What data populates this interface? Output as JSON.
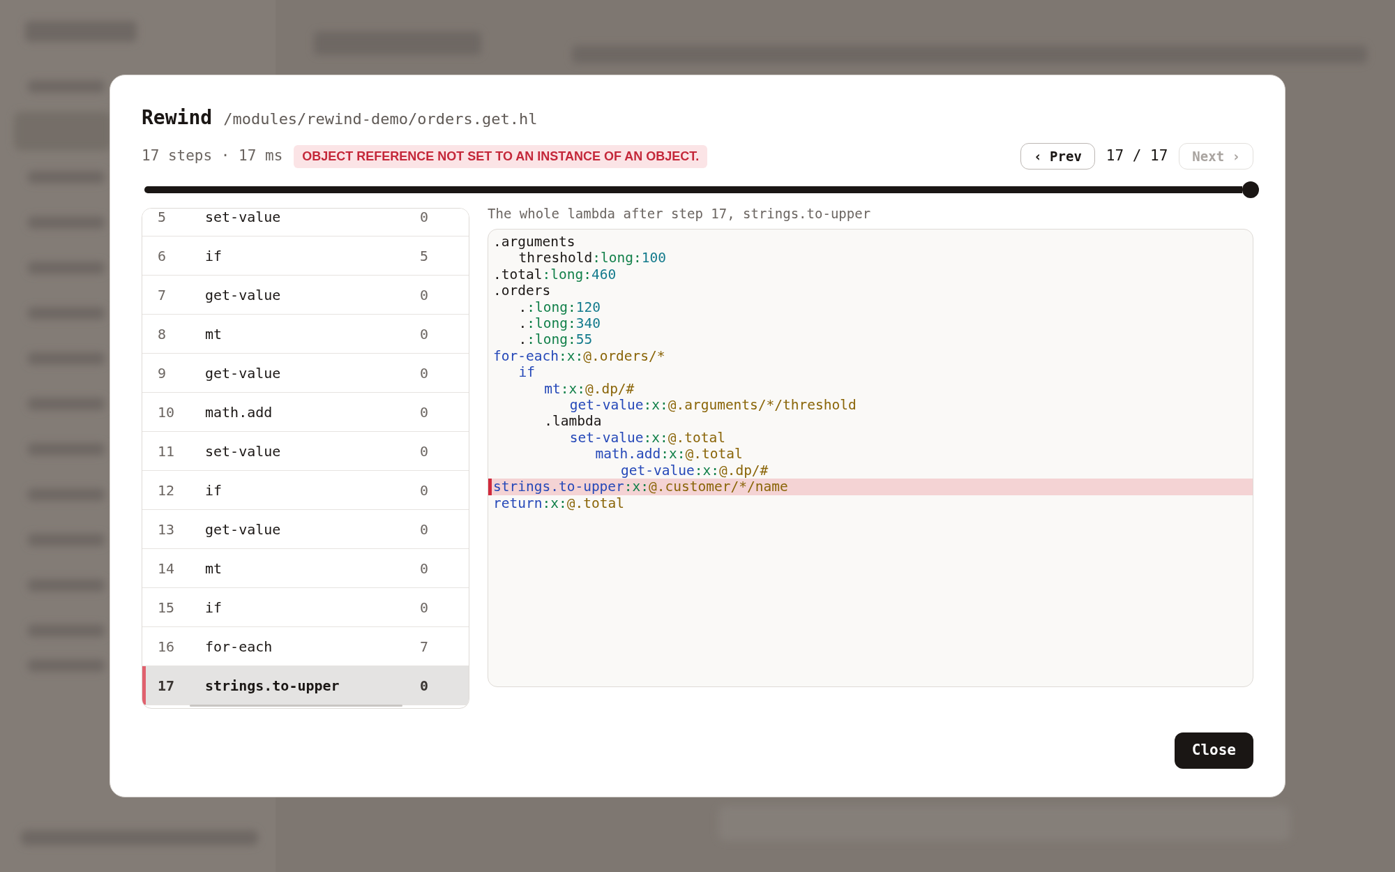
{
  "dialog": {
    "title": "Rewind",
    "path": "/modules/rewind-demo/orders.get.hl",
    "summary": "17 steps · 17 ms",
    "error": "OBJECT REFERENCE NOT SET TO AN INSTANCE OF AN OBJECT.",
    "prev": {
      "label": "‹ Prev",
      "disabled": false
    },
    "counter": "17 / 17",
    "next": {
      "label": "Next ›",
      "disabled": true
    },
    "timeline": {
      "level": 1
    },
    "steps": [
      {
        "number": "5",
        "name": "set-value",
        "count": "0",
        "selected": false
      },
      {
        "number": "6",
        "name": "if",
        "count": "5",
        "selected": false
      },
      {
        "number": "7",
        "name": "get-value",
        "count": "0",
        "selected": false
      },
      {
        "number": "8",
        "name": "mt",
        "count": "0",
        "selected": false
      },
      {
        "number": "9",
        "name": "get-value",
        "count": "0",
        "selected": false
      },
      {
        "number": "10",
        "name": "math.add",
        "count": "0",
        "selected": false
      },
      {
        "number": "11",
        "name": "set-value",
        "count": "0",
        "selected": false
      },
      {
        "number": "12",
        "name": "if",
        "count": "0",
        "selected": false
      },
      {
        "number": "13",
        "name": "get-value",
        "count": "0",
        "selected": false
      },
      {
        "number": "14",
        "name": "mt",
        "count": "0",
        "selected": false
      },
      {
        "number": "15",
        "name": "if",
        "count": "0",
        "selected": false
      },
      {
        "number": "16",
        "name": "for-each",
        "count": "7",
        "selected": false
      },
      {
        "number": "17",
        "name": "strings.to-upper",
        "count": "0",
        "selected": true
      }
    ],
    "code_caption": "The whole lambda after step 17, strings.to-upper",
    "code_lines": [
      {
        "selected": false,
        "tokens": [
          {
            "text": ".arguments",
            "kind": "plain"
          }
        ],
        "children": [
          {
            "selected": false,
            "tokens": [
              {
                "text": "threshold",
                "kind": "plain"
              },
              {
                "text": ":long:",
                "kind": "type"
              },
              {
                "text": "100",
                "kind": "number"
              }
            ]
          }
        ]
      },
      {
        "selected": false,
        "tokens": [
          {
            "text": ".total",
            "kind": "plain"
          },
          {
            "text": ":long:",
            "kind": "type"
          },
          {
            "text": "460",
            "kind": "number"
          }
        ]
      },
      {
        "selected": false,
        "tokens": [
          {
            "text": ".orders",
            "kind": "plain"
          }
        ],
        "children": [
          {
            "selected": false,
            "tokens": [
              {
                "text": ".",
                "kind": "plain"
              },
              {
                "text": ":long:",
                "kind": "type"
              },
              {
                "text": "120",
                "kind": "number"
              }
            ]
          },
          {
            "selected": false,
            "tokens": [
              {
                "text": ".",
                "kind": "plain"
              },
              {
                "text": ":long:",
                "kind": "type"
              },
              {
                "text": "340",
                "kind": "number"
              }
            ]
          },
          {
            "selected": false,
            "tokens": [
              {
                "text": ".",
                "kind": "plain"
              },
              {
                "text": ":long:",
                "kind": "type"
              },
              {
                "text": "55",
                "kind": "number"
              }
            ]
          }
        ]
      },
      {
        "selected": false,
        "tokens": [
          {
            "text": "for-each",
            "kind": "keyword"
          },
          {
            "text": ":x:",
            "kind": "type"
          },
          {
            "text": "@.orders/*",
            "kind": "expression"
          }
        ],
        "children": [
          {
            "selected": false,
            "tokens": [
              {
                "text": "if",
                "kind": "keyword"
              }
            ],
            "children": [
              {
                "selected": false,
                "tokens": [
                  {
                    "text": "mt",
                    "kind": "keyword"
                  },
                  {
                    "text": ":x:",
                    "kind": "type"
                  },
                  {
                    "text": "@.dp/#",
                    "kind": "expression"
                  }
                ],
                "children": [
                  {
                    "selected": false,
                    "tokens": [
                      {
                        "text": "get-value",
                        "kind": "keyword"
                      },
                      {
                        "text": ":x:",
                        "kind": "type"
                      },
                      {
                        "text": "@.arguments/*/threshold",
                        "kind": "expression"
                      }
                    ]
                  }
                ]
              },
              {
                "selected": false,
                "tokens": [
                  {
                    "text": ".lambda",
                    "kind": "plain"
                  }
                ],
                "children": [
                  {
                    "selected": false,
                    "tokens": [
                      {
                        "text": "set-value",
                        "kind": "keyword"
                      },
                      {
                        "text": ":x:",
                        "kind": "type"
                      },
                      {
                        "text": "@.total",
                        "kind": "expression"
                      }
                    ],
                    "children": [
                      {
                        "selected": false,
                        "tokens": [
                          {
                            "text": "math.add",
                            "kind": "keyword"
                          },
                          {
                            "text": ":x:",
                            "kind": "type"
                          },
                          {
                            "text": "@.total",
                            "kind": "expression"
                          }
                        ],
                        "children": [
                          {
                            "selected": false,
                            "tokens": [
                              {
                                "text": "get-value",
                                "kind": "keyword"
                              },
                              {
                                "text": ":x:",
                                "kind": "type"
                              },
                              {
                                "text": "@.dp/#",
                                "kind": "expression"
                              }
                            ]
                          }
                        ]
                      }
                    ]
                  }
                ]
              }
            ]
          }
        ]
      },
      {
        "selected": true,
        "tokens": [
          {
            "text": "strings.to-upper",
            "kind": "keyword"
          },
          {
            "text": ":x:",
            "kind": "type"
          },
          {
            "text": "@.customer/*/name",
            "kind": "expression"
          }
        ]
      },
      {
        "selected": false,
        "tokens": [
          {
            "text": "return",
            "kind": "keyword"
          },
          {
            "text": ":x:",
            "kind": "type"
          },
          {
            "text": "@.total",
            "kind": "expression"
          }
        ]
      }
    ],
    "close": "Close"
  }
}
